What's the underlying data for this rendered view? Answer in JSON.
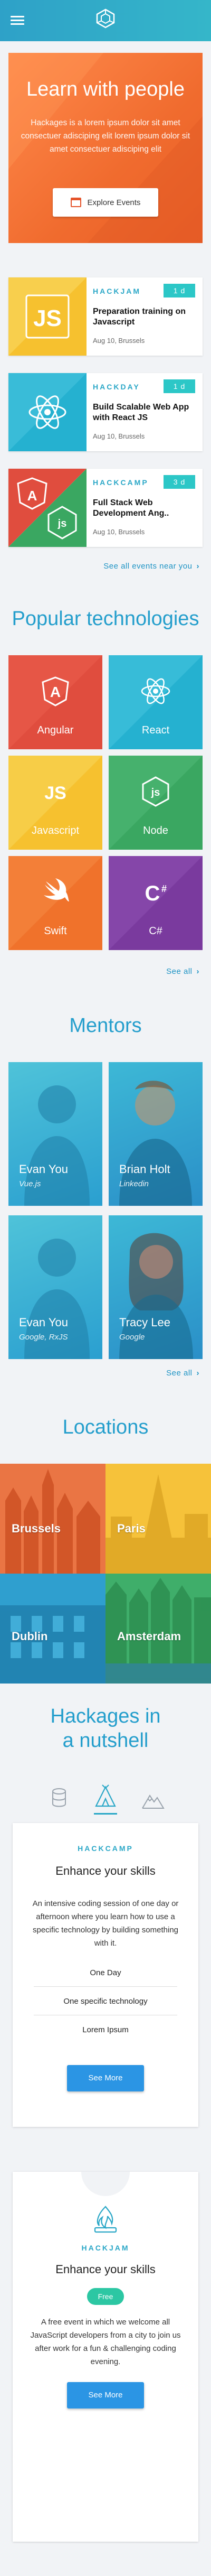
{
  "hero": {
    "title": "Learn with people",
    "text": "Hackages is a lorem ipsum dolor sit amet consectuer adisciping elit lorem ipsum dolor sit amet consectuer adisciping elit",
    "button": "Explore Events"
  },
  "events": [
    {
      "type": "HACKJAM",
      "badge": "1 d",
      "title": "Preparation training on Javascript",
      "meta": "Aug 10, Brussels",
      "tech": "JS"
    },
    {
      "type": "HACKDAY",
      "badge": "1 d",
      "title": "Build Scalable Web App with React JS",
      "meta": "Aug 10, Brussels",
      "tech": "React"
    },
    {
      "type": "HACKCAMP",
      "badge": "3 d",
      "title": "Full Stack Web Development Ang..",
      "meta": "Aug 10, Brussels",
      "tech": "Angular + Node"
    }
  ],
  "events_see_all": "See all events near you",
  "tech_title": "Popular technologies",
  "tech": [
    {
      "label": "Angular",
      "color": "#e04d3e",
      "icon": "angular-icon"
    },
    {
      "label": "React",
      "color": "#25b1d0",
      "icon": "react-icon"
    },
    {
      "label": "Javascript",
      "color": "#f6c12f",
      "icon": "js-icon"
    },
    {
      "label": "Node",
      "color": "#3aa761",
      "icon": "node-icon"
    },
    {
      "label": "Swift",
      "color": "#f0722b",
      "icon": "swift-icon"
    },
    {
      "label": "C#",
      "color": "#7a3a9e",
      "icon": "csharp-icon"
    }
  ],
  "tech_see_all": "See all",
  "mentors_title": "Mentors",
  "mentors": [
    {
      "name": "Evan You",
      "sub": "Vue.js"
    },
    {
      "name": "Brian Holt",
      "sub": "Linkedin"
    },
    {
      "name": "Evan You",
      "sub": "Google, RxJS"
    },
    {
      "name": "Tracy Lee",
      "sub": "Google"
    }
  ],
  "mentors_see_all": "See all",
  "locations_title": "Locations",
  "locations": [
    {
      "name": "Brussels"
    },
    {
      "name": "Paris"
    },
    {
      "name": "Dublin"
    },
    {
      "name": "Amsterdam"
    }
  ],
  "nutshell_title_1": "Hackages in",
  "nutshell_title_2": "a nutshell",
  "hackcamp": {
    "type": "HACKCAMP",
    "title": "Enhance your skills",
    "text": "An intensive coding session of one day or afternoon where you learn how to use a specific technology by building something with it.",
    "items": [
      "One Day",
      "One specific technology",
      "Lorem Ipsum"
    ],
    "button": "See More"
  },
  "hackjam": {
    "type": "HACKJAM",
    "title": "Enhance your skills",
    "badge": "Free",
    "text": "A free event in which we welcome all JavaScript developers from a city to join us after work for a fun & challenging coding evening.",
    "button": "See More"
  }
}
